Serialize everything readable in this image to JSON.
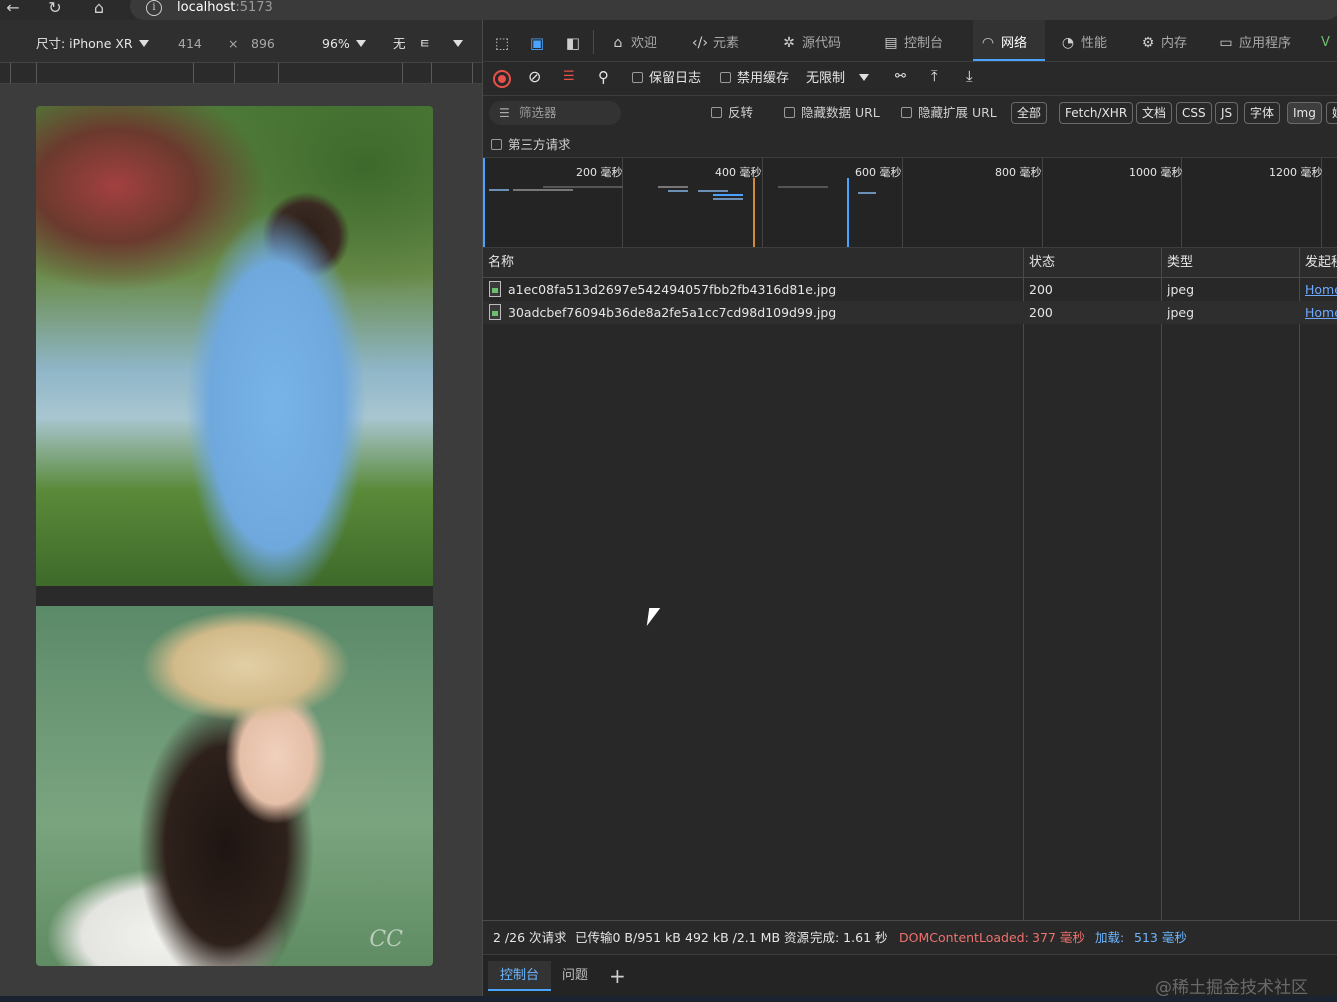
{
  "browser": {
    "url_host": "localhost",
    "url_port": ":5173"
  },
  "device_toolbar": {
    "size_label": "尺寸: iPhone XR",
    "width": "414",
    "times": "×",
    "height": "896",
    "zoom": "96%",
    "throttle": "无",
    "extra": "ㅌ"
  },
  "devtools": {
    "tabs": [
      {
        "label": "欢迎",
        "icon": "home-icon"
      },
      {
        "label": "元素",
        "icon": "code-icon"
      },
      {
        "label": "源代码",
        "icon": "bug-icon"
      },
      {
        "label": "控制台",
        "icon": "console-icon"
      },
      {
        "label": "网络",
        "icon": "wifi-icon"
      },
      {
        "label": "性能",
        "icon": "gauge-icon"
      },
      {
        "label": "内存",
        "icon": "chip-icon"
      },
      {
        "label": "应用程序",
        "icon": "window-icon"
      }
    ],
    "toolbar": {
      "preserve_log": "保留日志",
      "disable_cache": "禁用缓存",
      "throttling": "无限制"
    },
    "filter": {
      "placeholder": "筛选器",
      "invert": "反转",
      "hide_data_url": "隐藏数据 URL",
      "hide_ext_url": "隐藏扩展 URL",
      "chips": [
        "全部",
        "Fetch/XHR",
        "文档",
        "CSS",
        "JS",
        "字体",
        "Img",
        "媒"
      ],
      "third_party": "第三方请求"
    },
    "overview": {
      "labels": [
        "200 毫秒",
        "400 毫秒",
        "600 毫秒",
        "800 毫秒",
        "1000 毫秒",
        "1200 毫秒"
      ]
    },
    "table": {
      "headers": [
        "名称",
        "状态",
        "类型",
        "发起程"
      ],
      "rows": [
        {
          "name": "a1ec08fa513d2697e542494057fbb2fb4316d81e.jpg",
          "status": "200",
          "type": "jpeg",
          "initiator": "Home"
        },
        {
          "name": "30adcbef76094b36de8a2fe5a1cc7cd98d109d99.jpg",
          "status": "200",
          "type": "jpeg",
          "initiator": "Home"
        }
      ]
    },
    "status": {
      "requests": "2 /26 次请求",
      "transferred": "已传输0 B/951 kB",
      "resources": "492 kB /2.1 MB 资源",
      "finish": "完成: 1.61 秒",
      "dom_label": "DOMContentLoaded:",
      "dom_value": "377 毫秒",
      "load_label": "加载:",
      "load_value": "513 毫秒"
    },
    "drawer": {
      "tab_console": "控制台",
      "tab_issues": "问题",
      "watermark": "@稀土掘金技术社区"
    }
  }
}
